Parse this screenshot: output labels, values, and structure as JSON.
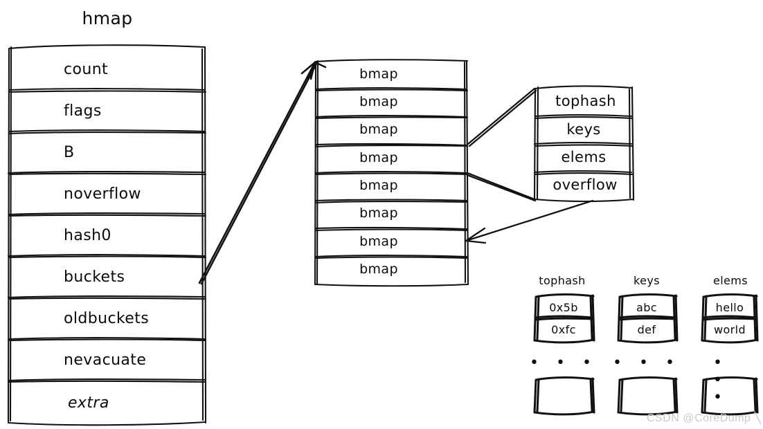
{
  "diagram": {
    "title": "hmap",
    "hmap": {
      "label": "hmap",
      "fields": [
        "count",
        "flags",
        "B",
        "noverflow",
        "hash0",
        "buckets",
        "oldbuckets",
        "nevacuate",
        "extra"
      ]
    },
    "buckets_array": {
      "cells": [
        "bmap",
        "bmap",
        "bmap",
        "bmap",
        "bmap",
        "bmap",
        "bmap",
        "bmap"
      ]
    },
    "bmap_detail": {
      "fields": [
        "tophash",
        "keys",
        "elems",
        "overflow"
      ]
    },
    "data_columns": [
      {
        "header": "tophash",
        "values": [
          "0x5b",
          "0xfc"
        ],
        "ellipsis": "• • •",
        "has_empty_box": true
      },
      {
        "header": "keys",
        "values": [
          "abc",
          "def"
        ],
        "ellipsis": "• • •",
        "has_empty_box": true
      },
      {
        "header": "elems",
        "values": [
          "hello",
          "world"
        ],
        "ellipsis": "• • •",
        "has_empty_box": true
      }
    ],
    "watermark": "CSDN @CoreDump ╲",
    "colors": {
      "ink": "#111111",
      "background": "#ffffff",
      "watermark": "#c9c9c9"
    }
  }
}
